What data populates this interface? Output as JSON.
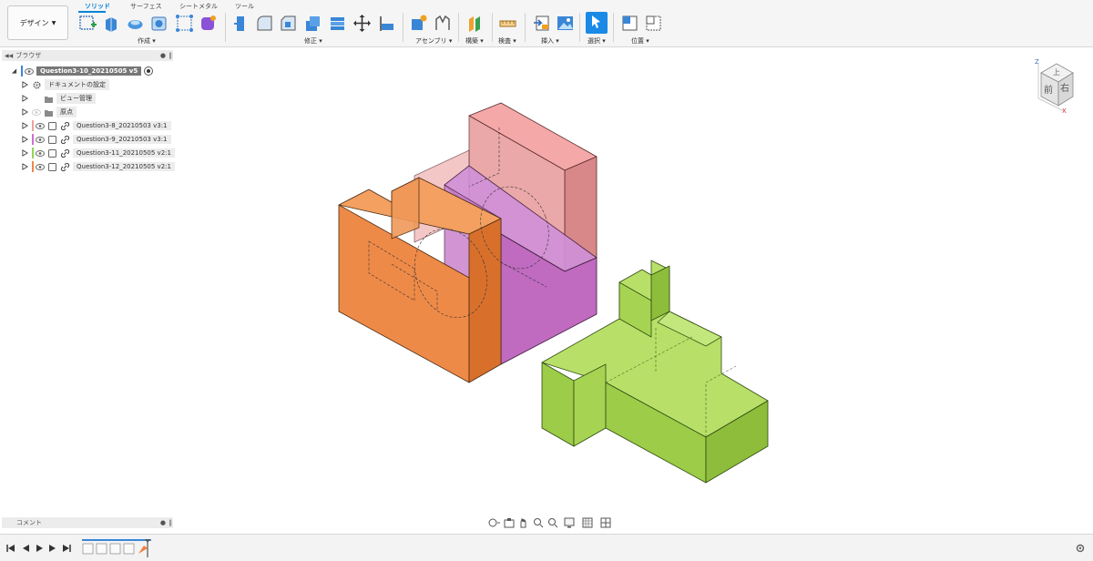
{
  "toolbar": {
    "workspace_label": "デザイン",
    "tabs": [
      {
        "label": "ソリッド",
        "active": true
      },
      {
        "label": "サーフェス",
        "active": false
      },
      {
        "label": "シートメタル",
        "active": false
      },
      {
        "label": "ツール",
        "active": false
      }
    ],
    "groups": {
      "create": "作成",
      "modify": "修正",
      "assemble": "アセンブリ",
      "construct": "構築",
      "inspect": "検査",
      "insert": "挿入",
      "select": "選択",
      "position": "位置"
    },
    "accent_color": "#0a84d8"
  },
  "browser": {
    "title": "ブラウザ",
    "root": "Question3-10_20210505 v5",
    "items": [
      {
        "label": "ドキュメントの設定",
        "icon": "gear-icon",
        "color": ""
      },
      {
        "label": "ビュー管理",
        "icon": "folder-icon",
        "color": ""
      },
      {
        "label": "原点",
        "icon": "folder-icon",
        "color": ""
      },
      {
        "label": "Question3-8_20210503 v3:1",
        "icon": "link-icon",
        "color": "#f0a0a0"
      },
      {
        "label": "Question3-9_20210503 v3:1",
        "icon": "link-icon",
        "color": "#d070d0"
      },
      {
        "label": "Question3-11_20210505 v2:1",
        "icon": "link-icon",
        "color": "#90d850"
      },
      {
        "label": "Question3-12_20210505 v2:1",
        "icon": "link-icon",
        "color": "#f08848"
      }
    ]
  },
  "viewcube": {
    "front": "前",
    "right": "右",
    "top": "上",
    "axis_z": "Z",
    "axis_x": "X"
  },
  "comments": {
    "title": "コメント"
  },
  "colors": {
    "pink_part": "#e88e8e",
    "magenta_part": "#c66ac6",
    "orange_part": "#ee8040",
    "green_part": "#a8d848"
  }
}
